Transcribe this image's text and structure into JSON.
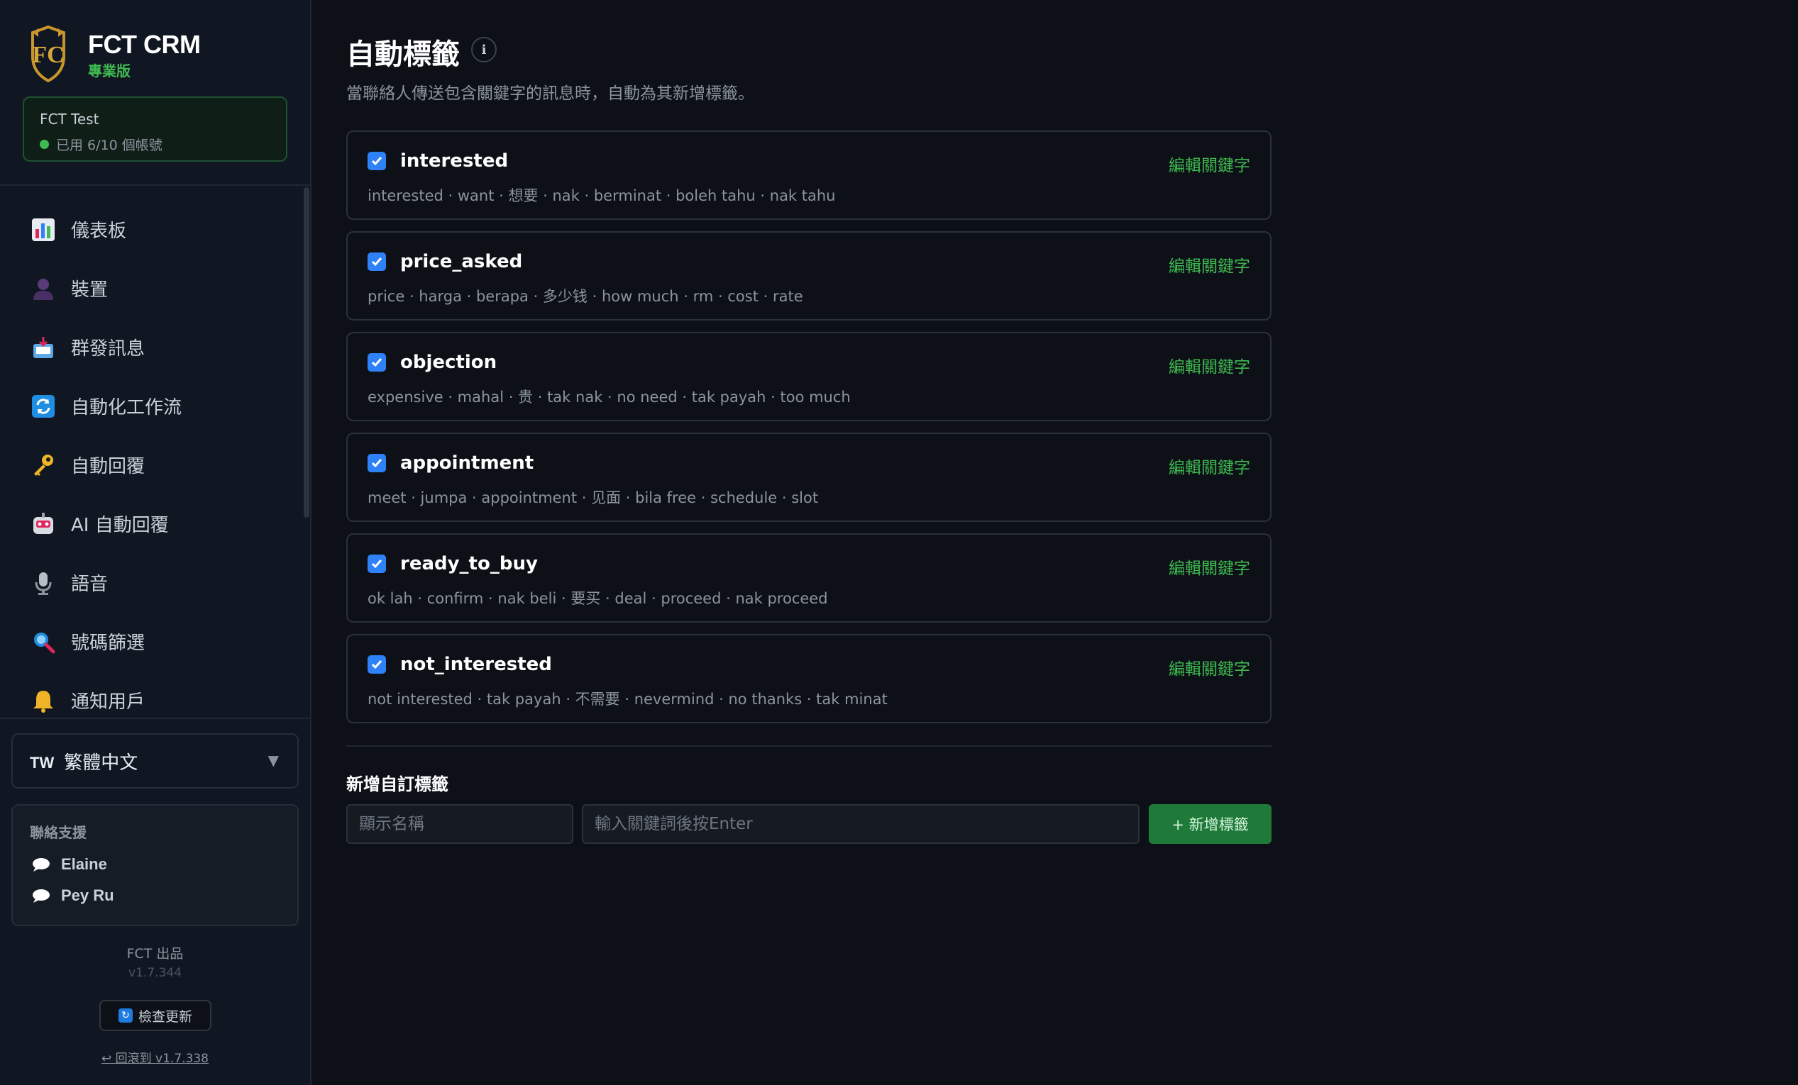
{
  "brand": {
    "title": "FCT CRM",
    "edition": "專業版"
  },
  "account": {
    "name": "FCT Test",
    "usage": "已用 6/10 個帳號"
  },
  "nav": [
    {
      "label": "儀表板",
      "icon": "chart-icon"
    },
    {
      "label": "裝置",
      "icon": "user-silhouette-icon"
    },
    {
      "label": "群發訊息",
      "icon": "inbox-icon"
    },
    {
      "label": "自動化工作流",
      "icon": "refresh-icon"
    },
    {
      "label": "自動回覆",
      "icon": "key-icon"
    },
    {
      "label": "AI 自動回覆",
      "icon": "robot-icon"
    },
    {
      "label": "語音",
      "icon": "microphone-icon"
    },
    {
      "label": "號碼篩選",
      "icon": "magnifier-icon"
    },
    {
      "label": "通知用戶",
      "icon": "bell-icon"
    }
  ],
  "language": {
    "code": "TW",
    "label": "繁體中文"
  },
  "support": {
    "title": "聯絡支援",
    "contacts": [
      "Elaine",
      "Pey Ru"
    ]
  },
  "footer": {
    "by": "FCT 出品",
    "version": "v1.7.344",
    "update_label": "檢查更新",
    "rollback_label": "↩ 回滾到 v1.7.338"
  },
  "page": {
    "title": "自動標籤",
    "subtitle": "當聯絡人傳送包含關鍵字的訊息時，自動為其新增標籤。"
  },
  "edit_label": "編輯關鍵字",
  "tags": [
    {
      "name": "interested",
      "checked": true,
      "keywords": "interested · want · 想要 · nak · berminat · boleh tahu · nak tahu"
    },
    {
      "name": "price_asked",
      "checked": true,
      "keywords": "price · harga · berapa · 多少钱 · how much · rm · cost · rate"
    },
    {
      "name": "objection",
      "checked": true,
      "keywords": "expensive · mahal · 贵 · tak nak · no need · tak payah · too much"
    },
    {
      "name": "appointment",
      "checked": true,
      "keywords": "meet · jumpa · appointment · 见面 · bila free · schedule · slot"
    },
    {
      "name": "ready_to_buy",
      "checked": true,
      "keywords": "ok lah · confirm · nak beli · 要买 · deal · proceed · nak proceed"
    },
    {
      "name": "not_interested",
      "checked": true,
      "keywords": "not interested · tak payah · 不需要 · nevermind · no thanks · tak minat"
    }
  ],
  "add_form": {
    "title": "新增自訂標籤",
    "name_placeholder": "顯示名稱",
    "keyword_placeholder": "輸入關鍵詞後按Enter",
    "button_label": "+ 新增標籤"
  },
  "colors": {
    "accent_green": "#3fb950",
    "checkbox_blue": "#2f81f7",
    "background": "#0d1117"
  }
}
